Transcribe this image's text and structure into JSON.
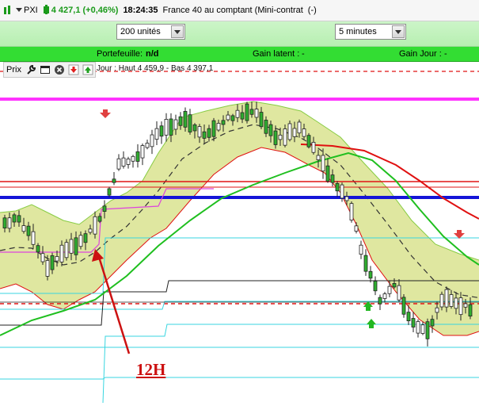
{
  "header": {
    "symbol": "PXI",
    "price_change": "4 427,1 (+0,46%)",
    "time": "18:24:35",
    "instrument": "France 40 au comptant (Mini-contrat",
    "instrument_suffix": "(-)"
  },
  "controls": {
    "units": {
      "selected": "200 unités"
    },
    "interval": {
      "selected": "5 minutes"
    }
  },
  "portfolio_bar": {
    "portefeuille_label": "Portefeuille:",
    "portefeuille_value": "n/d",
    "gain_latent_label": "Gain latent :",
    "gain_latent_value": "-",
    "gain_jour_label": "Gain Jour :",
    "gain_jour_value": "-"
  },
  "chart_toolbar": {
    "label": "Prix"
  },
  "info_line": "Jour : Haut 4 459,9 - Bas 4 397,1",
  "annotation": "12H",
  "colors": {
    "magenta_line": "#ff33ff",
    "red_line": "#e01515",
    "blue_line": "#1414d8",
    "band_fill": "#dfe7a0",
    "green_ma": "#1fbf1f",
    "red_ma": "#e01010",
    "cyan_line": "#38d6e0",
    "annotation": "#cc1111"
  },
  "icons": [
    "wrench-icon",
    "window-icon",
    "close-icon",
    "sell-arrow-icon",
    "buy-arrow-icon"
  ],
  "chart_data": {
    "type": "candlestick",
    "title": "",
    "ylabel": "",
    "xlabel": "",
    "grid": false,
    "day_high": 4459.9,
    "day_low": 4397.1
  }
}
